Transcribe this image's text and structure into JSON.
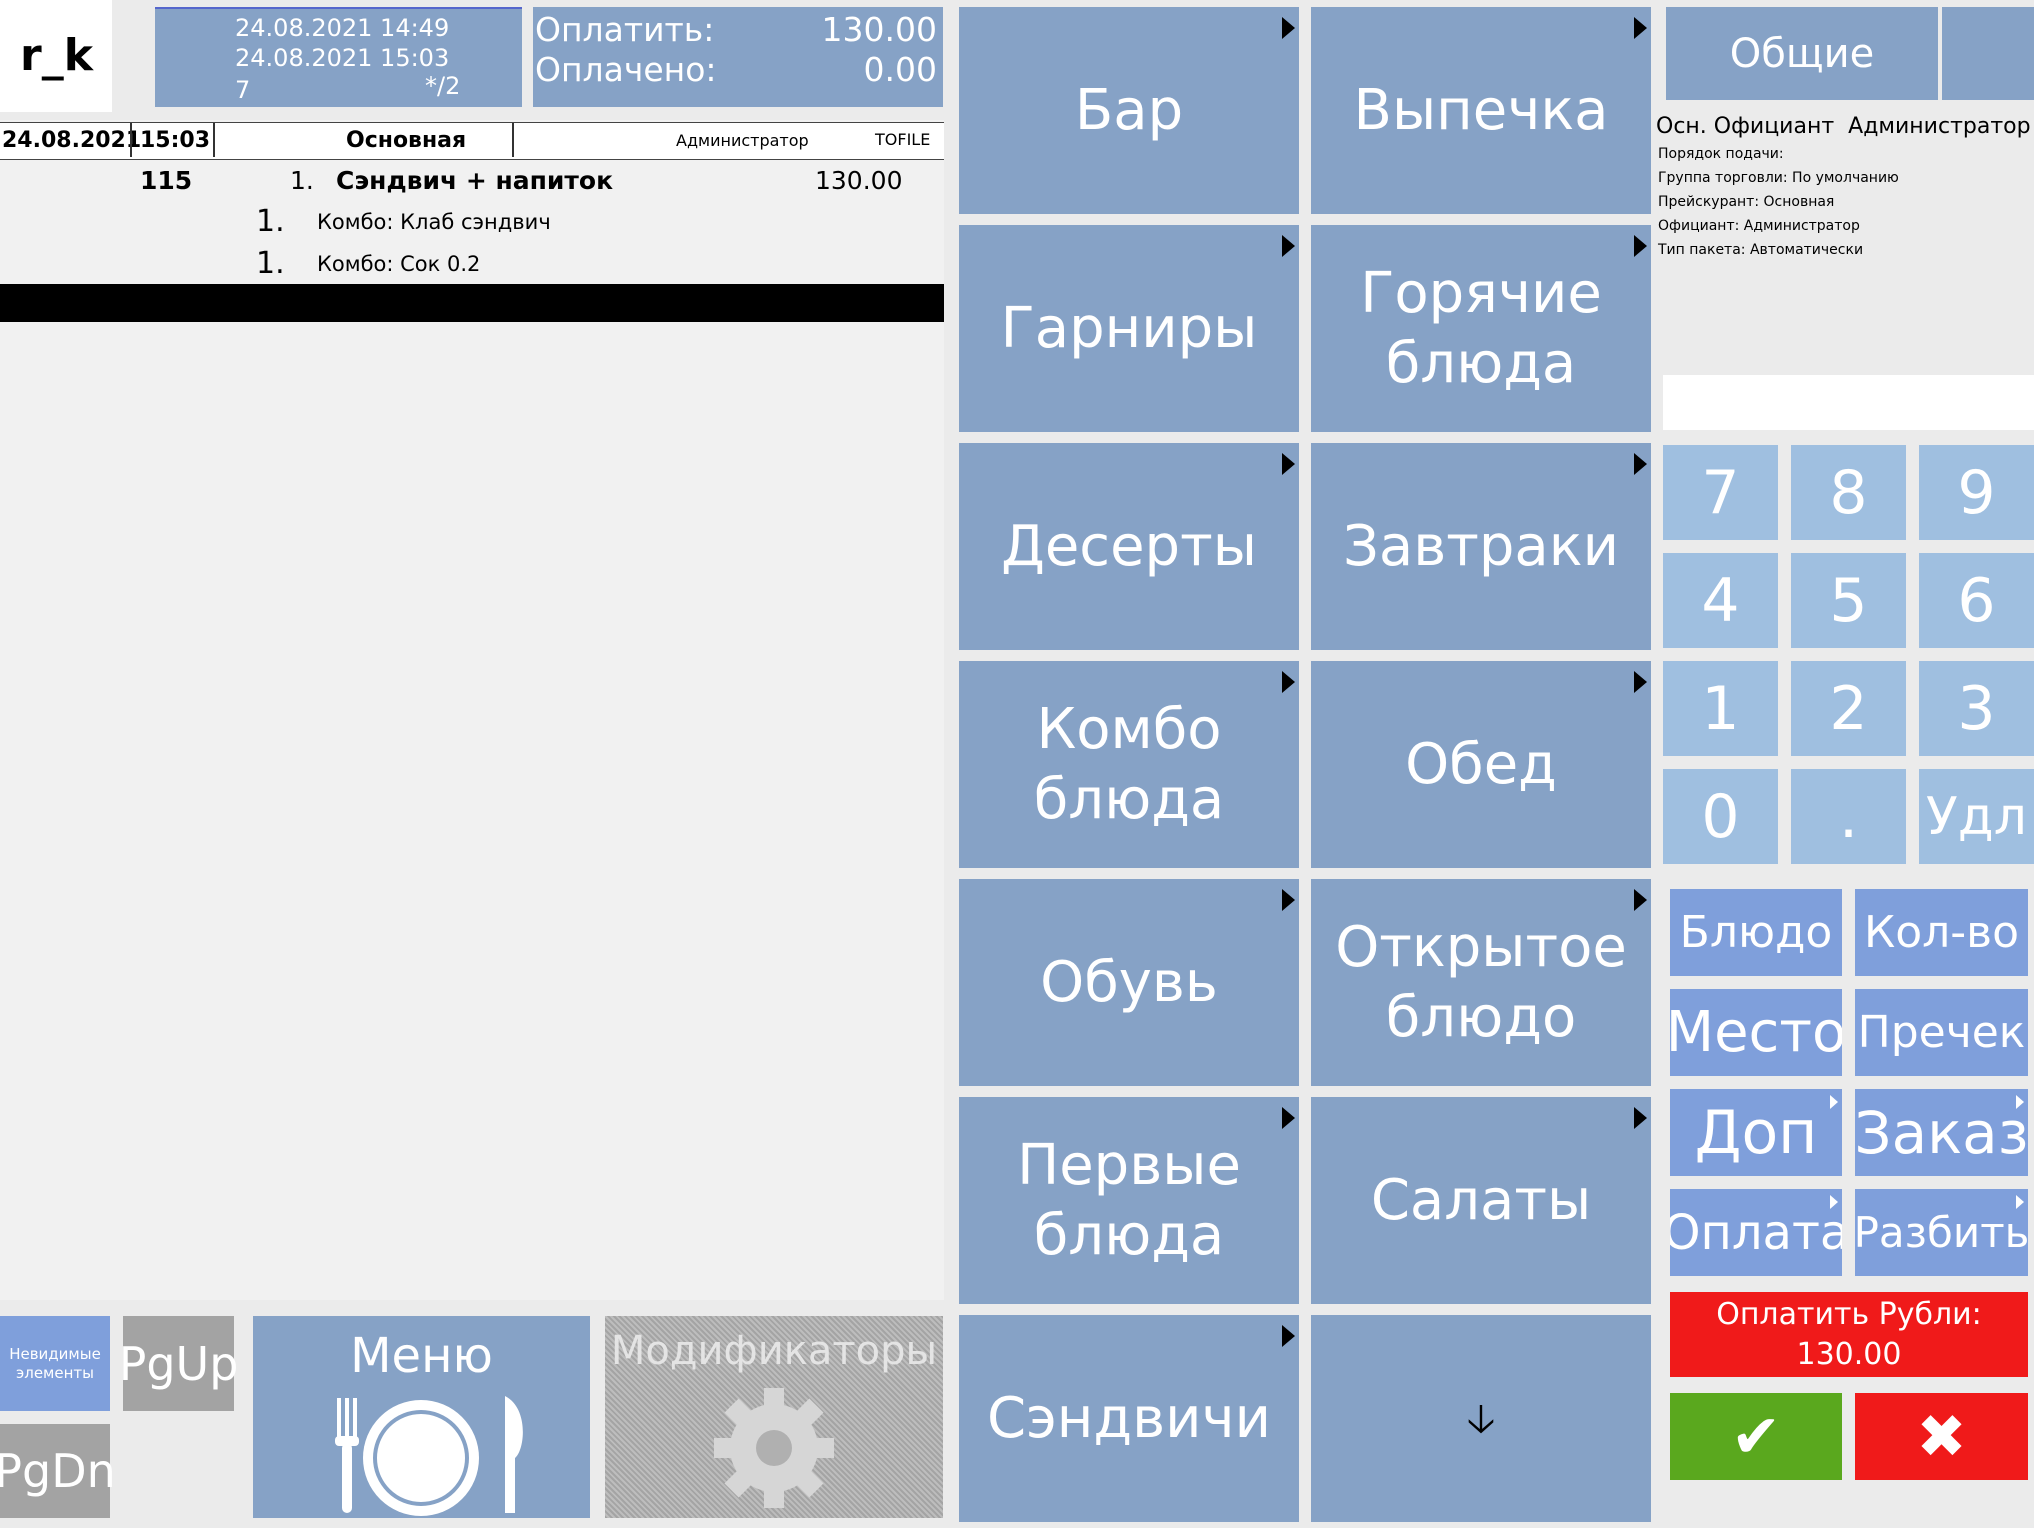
{
  "app": {
    "logo": "r_k"
  },
  "info": {
    "opened": "24.08.2021 14:49",
    "now": "24.08.2021 15:03",
    "table": "7",
    "guests": "*/2"
  },
  "totals": {
    "to_pay_label": "Оплатить:",
    "to_pay": "130.00",
    "paid_label": "Оплачено:",
    "paid": "0.00"
  },
  "order_header": {
    "date": "24.08.2021",
    "time": "15:03",
    "price_list": "Основная",
    "waiter": "Администратор",
    "station": "TOFILE"
  },
  "order": {
    "code": "115",
    "qty": "1.",
    "name": "Сэндвич + напиток",
    "price": "130.00",
    "mods": [
      {
        "qty": "1.",
        "name": "Комбо: Клаб сэндвич"
      },
      {
        "qty": "1.",
        "name": "Комбо: Сок 0.2"
      }
    ]
  },
  "categories": [
    {
      "label": "Бар",
      "arrow": true
    },
    {
      "label": "Выпечка",
      "arrow": true
    },
    {
      "label": "Гарниры",
      "arrow": true
    },
    {
      "label": "Горячие\nблюда",
      "arrow": true
    },
    {
      "label": "Десерты",
      "arrow": true
    },
    {
      "label": "Завтраки",
      "arrow": true
    },
    {
      "label": "Комбо\nблюда",
      "arrow": true
    },
    {
      "label": "Обед",
      "arrow": true
    },
    {
      "label": "Обувь",
      "arrow": true
    },
    {
      "label": "Открытое\nблюдо",
      "arrow": true
    },
    {
      "label": "Первые\nблюда",
      "arrow": true
    },
    {
      "label": "Салаты",
      "arrow": true
    },
    {
      "label": "Сэндвичи",
      "arrow": true
    },
    {
      "label": "🡣",
      "arrow": false
    }
  ],
  "bottom": {
    "hidden_items": "Невидимые элементы",
    "pgup": "PgUp",
    "pgdn": "PgDn",
    "menu": "Меню",
    "modifiers": "Модификаторы"
  },
  "right": {
    "tab": "Общие",
    "info_title": "Осн. Официант  Администратор",
    "info_lines": [
      "Порядок подачи:",
      "Группа торговли: По умолчанию",
      "Прейскурант: Основная",
      "Официант: Администратор",
      "Тип пакета: Автоматически"
    ],
    "keypad": [
      "7",
      "8",
      "9",
      "4",
      "5",
      "6",
      "1",
      "2",
      "3",
      "0",
      ".",
      "Удл"
    ],
    "actions": [
      {
        "label": "Блюдо",
        "arrow": false
      },
      {
        "label": "Кол-во",
        "arrow": false
      },
      {
        "label": "Место",
        "arrow": false
      },
      {
        "label": "Пречек",
        "arrow": false
      },
      {
        "label": "Доп",
        "arrow": true
      },
      {
        "label": "Заказ",
        "arrow": true
      },
      {
        "label": "Оплата",
        "arrow": true
      },
      {
        "label": "Разбить",
        "arrow": true
      }
    ],
    "pay_label": "Оплатить Рубли:",
    "pay_amount": "130.00",
    "ok": "✔",
    "cancel": "✖"
  },
  "colors": {
    "tile": "#86a2c6",
    "key": "#9fbfe0",
    "action": "#7f9fdb",
    "pay": "#f01a1a",
    "ok": "#5aa81e",
    "cancel": "#f01a1a"
  }
}
